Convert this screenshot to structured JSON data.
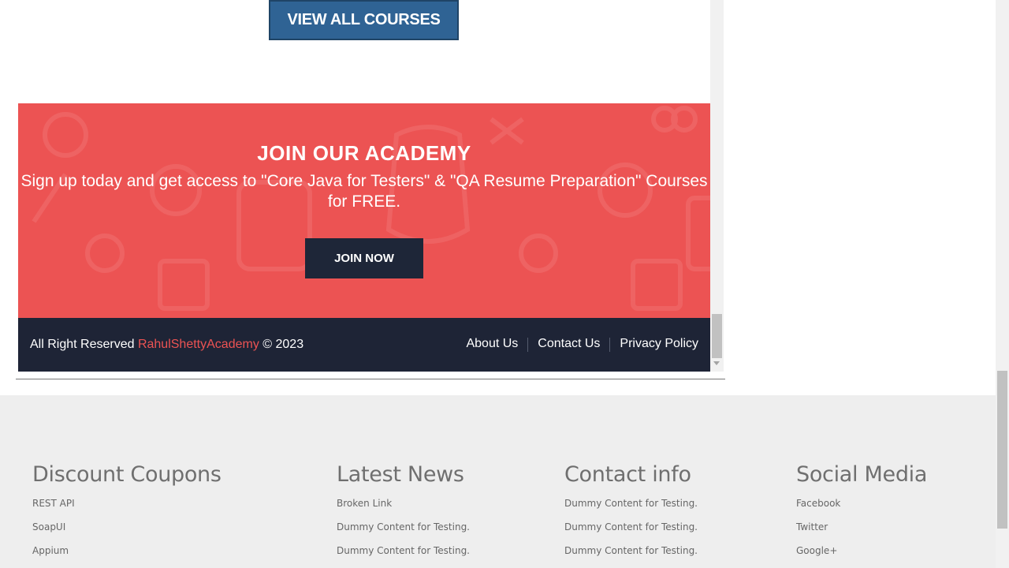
{
  "courses": {
    "view_all_label": "VIEW ALL COURSES"
  },
  "join": {
    "title": "JOIN OUR ACADEMY",
    "text": "Sign up today and get access to \"Core Java for Testers\" & \"QA Resume Preparation\" Courses for FREE.",
    "button_label": "JOIN NOW",
    "background_color": "#ec5353"
  },
  "footer_bar": {
    "prefix": "All Right Reserved",
    "brand": "RahulShettyAcademy",
    "suffix": "© 2023",
    "links": [
      "About Us",
      "Contact Us",
      "Privacy Policy"
    ]
  },
  "page_footer": {
    "columns": [
      {
        "heading": "Discount Coupons",
        "items": [
          "REST API",
          "SoapUI",
          "Appium"
        ]
      },
      {
        "heading": "Latest News",
        "items": [
          "Broken Link",
          "Dummy Content for Testing.",
          "Dummy Content for Testing."
        ]
      },
      {
        "heading": "Contact info",
        "items": [
          "Dummy Content for Testing.",
          "Dummy Content for Testing.",
          "Dummy Content for Testing."
        ]
      },
      {
        "heading": "Social Media",
        "items": [
          "Facebook",
          "Twitter",
          "Google+"
        ]
      }
    ]
  }
}
